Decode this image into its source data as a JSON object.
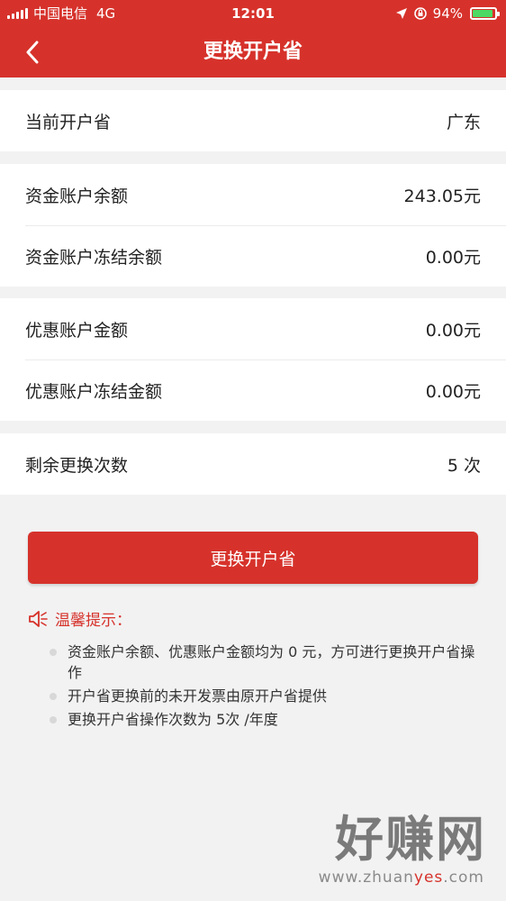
{
  "status_bar": {
    "carrier": "中国电信",
    "network": "4G",
    "time": "12:01",
    "battery": "94%",
    "battery_level": 0.94
  },
  "nav": {
    "title": "更换开户省",
    "back_icon": "chevron-left-icon"
  },
  "province_section": {
    "label": "当前开户省",
    "value": "广东"
  },
  "fund_section": {
    "rows": [
      {
        "label": "资金账户余额",
        "value": "243.05元"
      },
      {
        "label": "资金账户冻结余额",
        "value": "0.00元"
      }
    ]
  },
  "discount_section": {
    "rows": [
      {
        "label": "优惠账户金额",
        "value": "0.00元"
      },
      {
        "label": "优惠账户冻结金额",
        "value": "0.00元"
      }
    ]
  },
  "remaining_section": {
    "label": "剩余更换次数",
    "value": "5 次"
  },
  "action": {
    "button_label": "更换开户省"
  },
  "tips": {
    "title": "温馨提示：",
    "icon": "speaker-icon",
    "items": [
      "资金账户余额、优惠账户金额均为 0 元，方可进行更换开户省操作",
      "开户省更换前的未开发票由原开户省提供",
      "更换开户省操作次数为 5次 /年度"
    ]
  },
  "watermark": {
    "big_text": "好赚网",
    "url_pre": "www.zhuan",
    "url_hl": "yes",
    "url_post": ".com"
  },
  "colors": {
    "brand_red": "#d6322b",
    "background": "#f2f2f2",
    "battery_green": "#4cd964"
  }
}
